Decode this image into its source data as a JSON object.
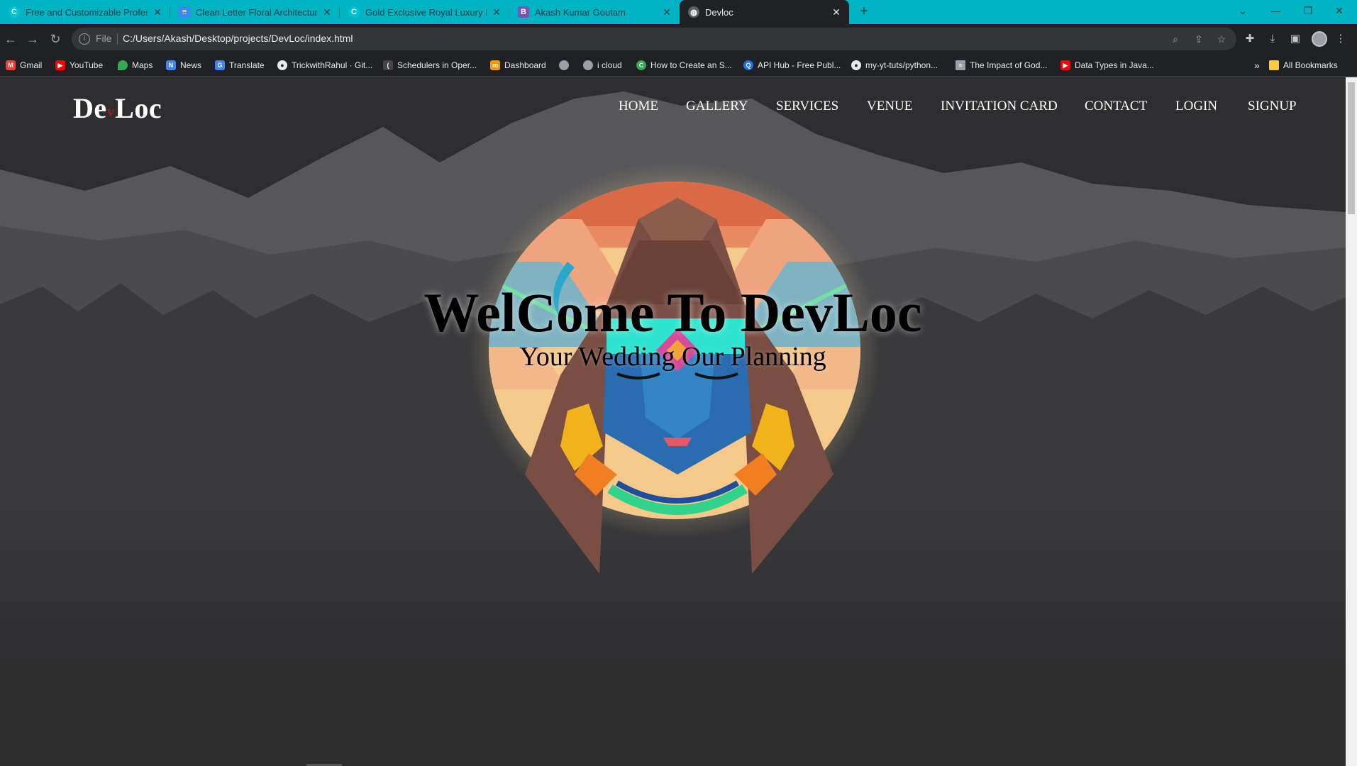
{
  "browser": {
    "tabs": [
      {
        "title": "Free and Customizable Professio",
        "icon": "canva-icon",
        "color": "#00c4cc"
      },
      {
        "title": "Clean Letter Floral Architecture",
        "icon": "docs-icon",
        "color": "#4285f4"
      },
      {
        "title": "Gold Exclusive Royal Luxury Hot",
        "icon": "canva-icon",
        "color": "#00c4cc"
      },
      {
        "title": "Akash Kumar Goutam",
        "icon": "bootstrap-icon",
        "color": "#7952b3"
      },
      {
        "title": "Devloc",
        "icon": "globe-icon",
        "color": "#9aa0a6"
      }
    ],
    "address": {
      "scheme_label": "File",
      "url": "C:/Users/Akash/Desktop/projects/DevLoc/index.html"
    },
    "bookmarks": [
      {
        "label": "Gmail",
        "icon": "gmail-icon",
        "color": "#ea4335"
      },
      {
        "label": "YouTube",
        "icon": "youtube-icon",
        "color": "#ff0000"
      },
      {
        "label": "Maps",
        "icon": "maps-icon",
        "color": "#34a853"
      },
      {
        "label": "News",
        "icon": "news-icon",
        "color": "#4285f4"
      },
      {
        "label": "Translate",
        "icon": "translate-icon",
        "color": "#4285f4"
      },
      {
        "label": "TrickwithRahul · Git...",
        "icon": "github-icon",
        "color": "#e8eaed"
      },
      {
        "label": "Schedulers in Oper...",
        "icon": "site-icon",
        "color": "#444"
      },
      {
        "label": "Dashboard",
        "icon": "dashboard-icon",
        "color": "#f29900"
      },
      {
        "label": "",
        "icon": "globe-icon",
        "color": "#9aa0a6"
      },
      {
        "label": "i cloud",
        "icon": "globe-icon",
        "color": "#9aa0a6"
      },
      {
        "label": "How to Create an S...",
        "icon": "site-icon",
        "color": "#34a853"
      },
      {
        "label": "API Hub - Free Publ...",
        "icon": "api-icon",
        "color": "#1a73e8"
      },
      {
        "label": "my-yt-tuts/python...",
        "icon": "github-icon",
        "color": "#e8eaed"
      },
      {
        "label": "The Impact of God...",
        "icon": "doc-icon",
        "color": "#9aa0a6"
      },
      {
        "label": "Data Types in Java...",
        "icon": "youtube-icon",
        "color": "#ff0000"
      }
    ],
    "all_bookmarks_label": "All Bookmarks"
  },
  "site": {
    "logo": {
      "part1": "De",
      "mark": "v",
      "part2": "Loc"
    },
    "nav": [
      "HOME",
      "GALLERY",
      "SERVICES",
      "VENUE",
      "INVITATION CARD",
      "CONTACT",
      "LOGIN",
      "SIGNUP"
    ],
    "headline": "WelCome To DevLoc",
    "subline": "Your Wedding Our Planning"
  }
}
